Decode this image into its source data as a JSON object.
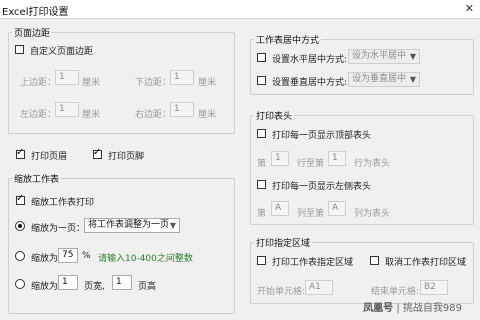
{
  "window": {
    "title": "Excel打印设置",
    "close_glyph": "✕"
  },
  "margins": {
    "group_label": "页面边距",
    "custom_label": "自定义页面边距",
    "custom_checked": false,
    "top_label": "上边距：",
    "top_value": "1",
    "top_unit": "厘米",
    "bottom_label": "下边距：",
    "bottom_value": "1",
    "bottom_unit": "厘米",
    "left_label": "左边距：",
    "left_value": "1",
    "left_unit": "厘米",
    "right_label": "右边距：",
    "right_value": "1",
    "right_unit": "厘米"
  },
  "print_header": {
    "label": "打印页眉",
    "checked": true
  },
  "print_footer": {
    "label": "打印页脚",
    "checked": true
  },
  "scaling": {
    "group_label": "缩放工作表",
    "scale_print_label": "缩放工作表打印",
    "scale_print_checked": true,
    "fit_one_page_label": "缩放为一页：",
    "fit_one_page_selected": true,
    "fit_one_page_option": "将工作表调整为一页",
    "scale_percent_label": "缩放为",
    "scale_percent_value": "75",
    "percent_sign": "%",
    "hint": "请输入10-400之间整数",
    "fit_pages_label": "缩放为",
    "pages_wide_value": "1",
    "pages_wide_label": "页宽,",
    "pages_tall_value": "1",
    "pages_tall_label": "页高"
  },
  "centering": {
    "group_label": "工作表居中方式",
    "horizontal_label": "设置水平居中方式:",
    "horizontal_value": "设为水平居中",
    "vertical_label": "设置垂直居中方式:",
    "vertical_value": "设为垂直居中"
  },
  "print_titles": {
    "group_label": "打印表头",
    "rows_label": "打印每一页显示顶部表头",
    "row_prefix": "第",
    "row_from": "1",
    "row_mid": "行至第",
    "row_to": "1",
    "row_suffix": "行为表头",
    "cols_label": "打印每一页显示左侧表头",
    "col_prefix": "第",
    "col_from": "A",
    "col_mid": "列至第",
    "col_to": "A",
    "col_suffix": "列为表头"
  },
  "print_area": {
    "group_label": "打印指定区域",
    "set_label": "打印工作表指定区域",
    "cancel_label": "取消工作表打印区域",
    "start_label": "开始单元格:",
    "start_value": "A1",
    "end_label": "结束单元格:",
    "end_value": "B2"
  },
  "watermark": {
    "logo": "凤凰号",
    "text": "挑战自我989"
  }
}
